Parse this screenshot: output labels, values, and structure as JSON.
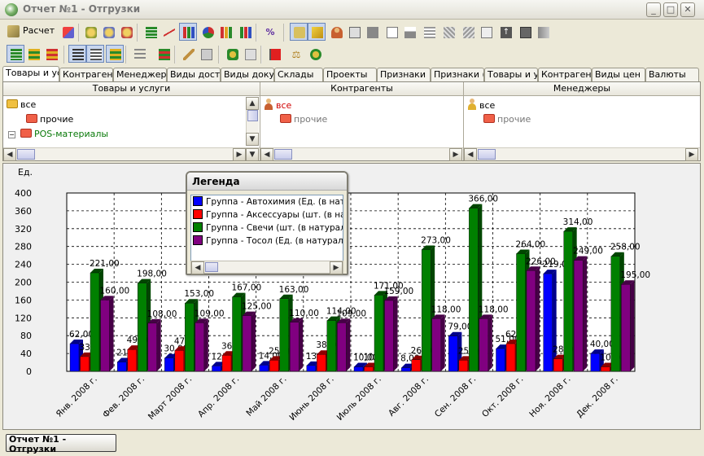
{
  "window": {
    "title": "Отчет №1 - Отгрузки",
    "minimize": "_",
    "maximize": "□",
    "close": "✕"
  },
  "toolbar": {
    "raschet_label": "Расчет"
  },
  "filter_tabs": [
    "Товары и ус",
    "Контрагенты",
    "Менеджеры",
    "Виды доставк",
    "Виды докум",
    "Склады",
    "Проекты",
    "Признаки",
    "Признаки (Т",
    "Товары и ус",
    "Контрагенты",
    "Виды цен",
    "Валюты"
  ],
  "panels": {
    "goods": {
      "header": "Товары и услуги",
      "items": [
        "все",
        "прочие",
        "POS-материалы"
      ]
    },
    "counterparties": {
      "header": "Контрагенты",
      "items": [
        "все",
        "прочие"
      ]
    },
    "managers": {
      "header": "Менеджеры",
      "items": [
        "все",
        "прочие"
      ]
    }
  },
  "legend": {
    "title": "Легенда",
    "items": [
      {
        "label": "Группа - Автохимия (Ед. (в натура",
        "color": "#0000ff"
      },
      {
        "label": "Группа - Аксессуары (шт. (в натур",
        "color": "#ff0000"
      },
      {
        "label": "Группа - Свечи (шт. (в натуральны",
        "color": "#008000"
      },
      {
        "label": "Группа - Тосол (Ед. (в натуральны",
        "color": "#800080"
      }
    ]
  },
  "chart_data": {
    "type": "bar",
    "ylabel": "Ед.",
    "ylim": [
      0,
      400
    ],
    "yticks": [
      0,
      40,
      80,
      120,
      160,
      200,
      240,
      280,
      320,
      360,
      400
    ],
    "grid": true,
    "categories": [
      "Янв. 2008 г.",
      "Фев. 2008 г.",
      "Март 2008 г.",
      "Апр. 2008 г.",
      "Май 2008 г.",
      "Июнь 2008 г.",
      "Июль 2008 г.",
      "Авг. 2008 г.",
      "Сен. 2008 г.",
      "Окт. 2008 г.",
      "Ноя. 2008 г.",
      "Дек. 2008 г."
    ],
    "series": [
      {
        "name": "Группа - Автохимия (Ед. (в натура",
        "color": "#0000ff",
        "values": [
          62,
          21,
          30,
          12,
          14,
          13,
          10,
          8,
          79,
          51,
          219,
          40
        ],
        "labels": [
          "62,00",
          "21,00",
          "30,00",
          "12,00",
          "14,00",
          "13,00",
          "10,00",
          "8,00",
          "79,00",
          "51,00",
          "219,00",
          "40,00"
        ]
      },
      {
        "name": "Группа - Аксессуары (шт. (в натур",
        "color": "#ff0000",
        "values": [
          33,
          49,
          47,
          36,
          25,
          38,
          10,
          26,
          25,
          62,
          28,
          10
        ],
        "labels": [
          "33,00",
          "49,00",
          "47,00",
          "36,00",
          "25,00",
          "38,00",
          "10,00",
          "26,00",
          "25,00",
          "62,00",
          "28,00",
          "10,00"
        ]
      },
      {
        "name": "Группа - Свечи (шт. (в натуральны",
        "color": "#008000",
        "values": [
          221,
          198,
          153,
          167,
          163,
          114,
          171,
          273,
          366,
          264,
          314,
          258
        ],
        "labels": [
          "221,00",
          "198,00",
          "153,00",
          "167,00",
          "163,00",
          "114,00",
          "171,00",
          "273,00",
          "366,00",
          "264,00",
          "314,00",
          "258,00"
        ]
      },
      {
        "name": "Группа - Тосол (Ед. (в натуральны",
        "color": "#800080",
        "values": [
          160,
          108,
          109,
          125,
          110,
          109,
          159,
          118,
          118,
          226,
          249,
          195
        ],
        "labels": [
          "160,00",
          "108,00",
          "109,00",
          "125,00",
          "110,00",
          "109,00",
          "159,00",
          "118,00",
          "118,00",
          "226,00",
          "249,00",
          "195,00"
        ]
      }
    ]
  },
  "status": {
    "report_label": "Отчет №1 - Отгрузки"
  }
}
